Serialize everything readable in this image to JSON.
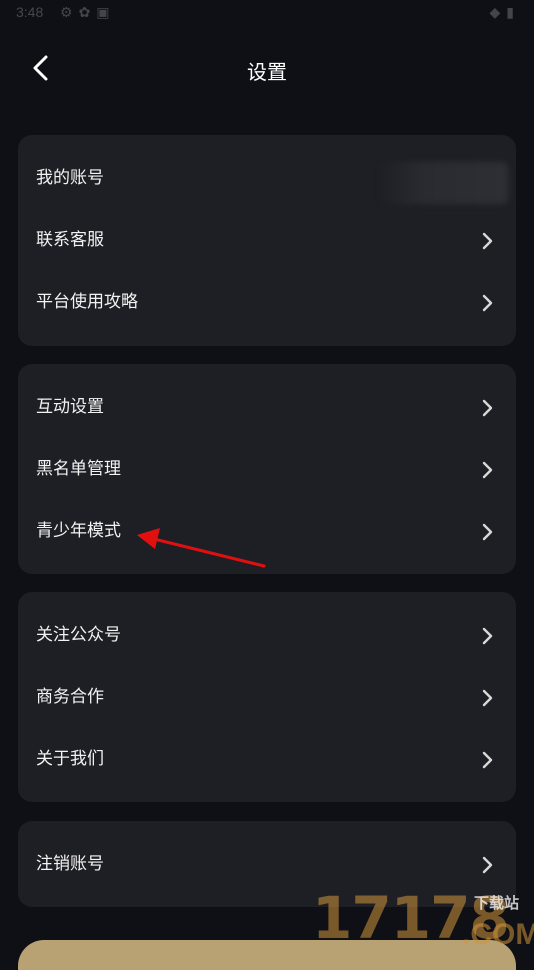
{
  "status_bar": {
    "time": "3:48",
    "left_icons": [
      "settings-icon",
      "sync-icon",
      "notification-icon"
    ],
    "right_icons": [
      "wifi-icon",
      "battery-icon"
    ]
  },
  "header": {
    "title": "设置",
    "back_icon": "chevron-left-icon"
  },
  "groups": [
    {
      "items": [
        {
          "label": "我的账号",
          "value_obscured": true
        },
        {
          "label": "联系客服",
          "icon": "chevron-right-icon"
        },
        {
          "label": "平台使用攻略",
          "icon": "chevron-right-icon"
        }
      ]
    },
    {
      "items": [
        {
          "label": "互动设置",
          "icon": "chevron-right-icon"
        },
        {
          "label": "黑名单管理",
          "icon": "chevron-right-icon"
        },
        {
          "label": "青少年模式",
          "icon": "chevron-right-icon"
        }
      ]
    },
    {
      "items": [
        {
          "label": "关注公众号",
          "icon": "chevron-right-icon"
        },
        {
          "label": "商务合作",
          "icon": "chevron-right-icon"
        },
        {
          "label": "关于我们",
          "icon": "chevron-right-icon"
        }
      ]
    },
    {
      "items": [
        {
          "label": "注销账号",
          "icon": "chevron-right-icon"
        }
      ]
    }
  ],
  "annotation": {
    "type": "arrow",
    "points_to": "青少年模式",
    "color": "#e01010"
  },
  "watermark": {
    "digits": "17178",
    "suffix": ".COM",
    "site_label": "下载站"
  },
  "colors": {
    "background": "#0f1016",
    "card": "#1e1f25",
    "text": "#f2f2f2",
    "chevron": "#d8d8d8",
    "bottom_banner": "#b8a172"
  }
}
